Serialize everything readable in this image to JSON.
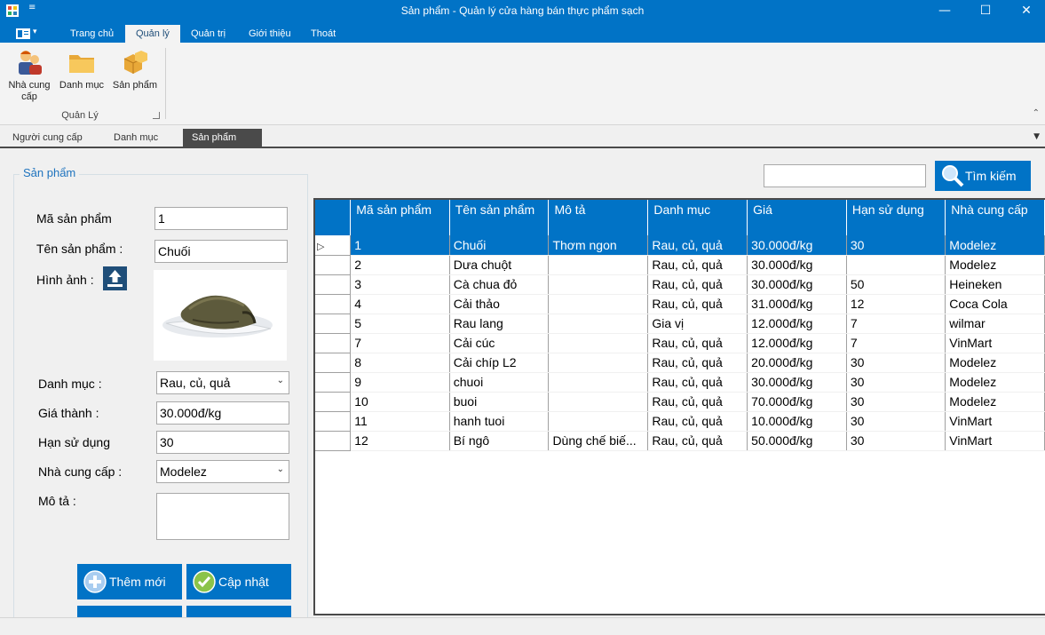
{
  "window": {
    "title": "Sản phẩm - Quản lý cửa hàng bán thực phẩm sạch",
    "qat_symbol": "≡",
    "controls": {
      "minimize": "—",
      "maximize": "☐",
      "close": "✕"
    }
  },
  "ribbon": {
    "app_menu_symbol": "▾",
    "tabs": [
      "Trang chủ",
      "Quản lý",
      "Quản trị",
      "Giới thiệu",
      "Thoát"
    ],
    "active_tab": "Quản lý",
    "buttons": [
      "Nhà cung cấp",
      "Danh mục",
      "Sản phẩm"
    ],
    "group_label": "Quản Lý",
    "collapse_symbol": "⌃"
  },
  "doc_tabs": {
    "items": [
      "Người cung cấp",
      "Danh mục",
      "Sản phẩm"
    ],
    "active": "Sản phẩm",
    "close_symbol": "✕",
    "dropdown_symbol": "▼"
  },
  "form": {
    "legend": "Sản phẩm",
    "labels": {
      "ma": "Mã sản phẩm",
      "ten": "Tên sản phẩm :",
      "hinh": "Hình ảnh :",
      "danhmuc": "Danh mục :",
      "gia": "Giá thành :",
      "han": "Hạn sử dụng",
      "ncc": "Nhà cung cấp :",
      "mota": "Mô tả :"
    },
    "values": {
      "ma": "1",
      "ten": "Chuối",
      "danhmuc": "Rau, củ, quả",
      "gia": "30.000đ/kg",
      "han": "30",
      "ncc": "Modelez",
      "mota": ""
    },
    "select_arrow": "⌄",
    "buttons": {
      "add": "Thêm mới",
      "update": "Cập nhật"
    }
  },
  "search": {
    "value": "",
    "button_label": "Tìm kiếm"
  },
  "grid": {
    "columns": [
      "Mã sản phẩm",
      "Tên sản phẩm",
      "Mô tả",
      "Danh mục",
      "Giá",
      "Hạn sử dụng",
      "Nhà cung cấp"
    ],
    "current_row_marker": "▷",
    "rows": [
      {
        "ma": "1",
        "ten": "Chuối",
        "mota": "Thơm ngon",
        "danhmuc": "Rau, củ, quả",
        "gia": "30.000đ/kg",
        "han": "30",
        "ncc": "Modelez"
      },
      {
        "ma": "2",
        "ten": "Dưa chuột",
        "mota": "",
        "danhmuc": "Rau, củ, quả",
        "gia": "30.000đ/kg",
        "han": "",
        "ncc": "Modelez"
      },
      {
        "ma": "3",
        "ten": "Cà chua đỏ",
        "mota": "",
        "danhmuc": "Rau, củ, quả",
        "gia": "30.000đ/kg",
        "han": "50",
        "ncc": "Heineken"
      },
      {
        "ma": "4",
        "ten": "Cải thảo",
        "mota": "",
        "danhmuc": "Rau, củ, quả",
        "gia": "31.000đ/kg",
        "han": "12",
        "ncc": "Coca Cola"
      },
      {
        "ma": "5",
        "ten": "Rau lang",
        "mota": "",
        "danhmuc": "Gia vị",
        "gia": "12.000đ/kg",
        "han": "7",
        "ncc": "wilmar"
      },
      {
        "ma": "7",
        "ten": "Cải cúc",
        "mota": "",
        "danhmuc": "Rau, củ, quả",
        "gia": "12.000đ/kg",
        "han": "7",
        "ncc": "VinMart"
      },
      {
        "ma": "8",
        "ten": "Cải chíp L2",
        "mota": "",
        "danhmuc": "Rau, củ, quả",
        "gia": "20.000đ/kg",
        "han": "30",
        "ncc": "Modelez"
      },
      {
        "ma": "9",
        "ten": "chuoi",
        "mota": "",
        "danhmuc": "Rau, củ, quả",
        "gia": "30.000đ/kg",
        "han": "30",
        "ncc": "Modelez"
      },
      {
        "ma": "10",
        "ten": "buoi",
        "mota": "",
        "danhmuc": "Rau, củ, quả",
        "gia": "70.000đ/kg",
        "han": "30",
        "ncc": "Modelez"
      },
      {
        "ma": "11",
        "ten": "hanh tuoi",
        "mota": "",
        "danhmuc": "Rau, củ, quả",
        "gia": "10.000đ/kg",
        "han": "30",
        "ncc": "VinMart"
      },
      {
        "ma": "12",
        "ten": "Bí ngô",
        "mota": "Dùng chế biế...",
        "danhmuc": "Rau, củ, quả",
        "gia": "50.000đ/kg",
        "han": "30",
        "ncc": "VinMart"
      }
    ],
    "selected_index": 0
  },
  "colors": {
    "accent": "#0173c6",
    "grid_border": "#4a4a4a"
  }
}
